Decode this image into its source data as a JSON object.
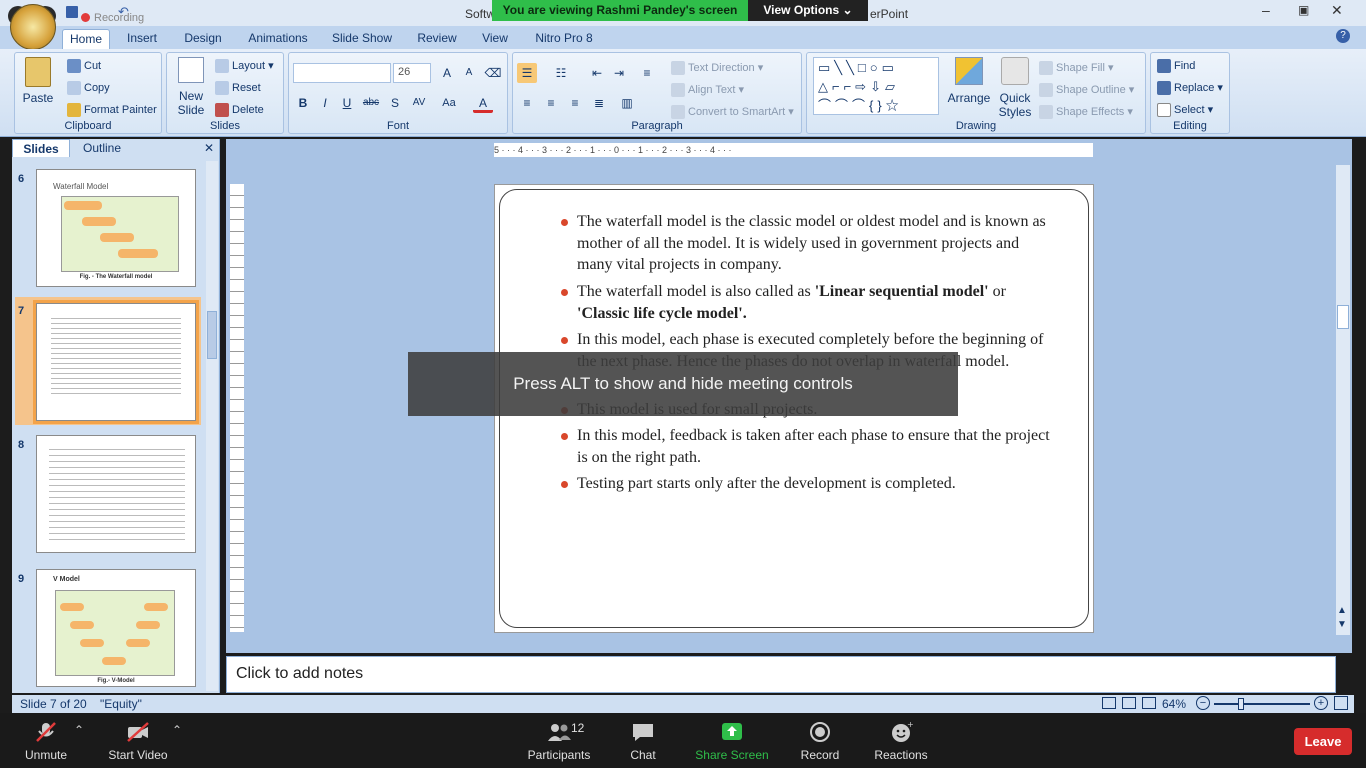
{
  "titlebar": {
    "title_left": "Softw",
    "title_right": "erPoint"
  },
  "meeting": {
    "banner": "You are viewing Rashmi Pandey's screen",
    "view_options": "View Options",
    "recording_badge": "Recording",
    "alt_message": "Press ALT to show and hide meeting controls"
  },
  "ribbon_tabs": [
    "Home",
    "Insert",
    "Design",
    "Animations",
    "Slide Show",
    "Review",
    "View",
    "Nitro Pro 8"
  ],
  "ribbon": {
    "clipboard": {
      "label": "Clipboard",
      "paste": "Paste",
      "cut": "Cut",
      "copy": "Copy",
      "format_painter": "Format Painter"
    },
    "slides": {
      "label": "Slides",
      "new_slide_line1": "New",
      "new_slide_line2": "Slide",
      "layout": "Layout",
      "reset": "Reset",
      "delete": "Delete"
    },
    "font": {
      "label": "Font",
      "font_name": "",
      "font_size": "26"
    },
    "paragraph": {
      "label": "Paragraph",
      "text_direction": "Text Direction",
      "align_text": "Align Text",
      "convert_smartart": "Convert to SmartArt"
    },
    "drawing": {
      "label": "Drawing",
      "arrange": "Arrange",
      "quick_styles_line1": "Quick",
      "quick_styles_line2": "Styles",
      "shape_fill": "Shape Fill",
      "shape_outline": "Shape Outline",
      "shape_effects": "Shape Effects"
    },
    "editing": {
      "label": "Editing",
      "find": "Find",
      "replace": "Replace",
      "select": "Select"
    }
  },
  "left_pane": {
    "tabs": [
      "Slides",
      "Outline"
    ],
    "thumbnails": [
      {
        "number": "6",
        "title": "Waterfall Model",
        "caption": "Fig. - The Waterfall model"
      },
      {
        "number": "7",
        "title": "",
        "caption": ""
      },
      {
        "number": "8",
        "title": "",
        "caption": ""
      },
      {
        "number": "9",
        "title": "V Model",
        "caption": "Fig.- V-Model"
      }
    ],
    "selected_slide": "7"
  },
  "ruler": {
    "h": "5 · · · 4 · · · 3 · · · 2 · · · 1 · · · 0 · · · 1 · · · 2 · · · 3 · · · 4 · · ·"
  },
  "slide": {
    "bullets": [
      {
        "text": "The waterfall model is the classic model or oldest model and is known as mother of all the model. It is widely used in government projects and many vital projects in company."
      },
      {
        "pre": "The waterfall model is also called as ",
        "bold1": "'Linear sequential model'",
        "mid": " or ",
        "bold2": "'Classic life cycle model'."
      },
      {
        "text": "In this model, each phase is executed completely before the beginning of the next phase. Hence the phases do not overlap in waterfall model."
      },
      {
        "text": "This model is used for small projects."
      },
      {
        "text": "In this model, feedback is taken after each phase to ensure that the project is on the right path."
      },
      {
        "text": "Testing part starts only after the development is completed."
      }
    ]
  },
  "notes": {
    "placeholder": "Click to add notes"
  },
  "status": {
    "slide_info": "Slide 7 of 20",
    "theme": "\"Equity\"",
    "zoom": "64%"
  },
  "toolbar": {
    "unmute": "Unmute",
    "start_video": "Start Video",
    "participants": "Participants",
    "participants_count": "12",
    "chat": "Chat",
    "share_screen": "Share Screen",
    "record": "Record",
    "reactions": "Reactions",
    "leave": "Leave"
  },
  "colors": {
    "share_green": "#2fbe4a",
    "leave_red": "#d62c2c",
    "bullet_red": "#d9472b",
    "selection_orange": "#f3a34a"
  }
}
